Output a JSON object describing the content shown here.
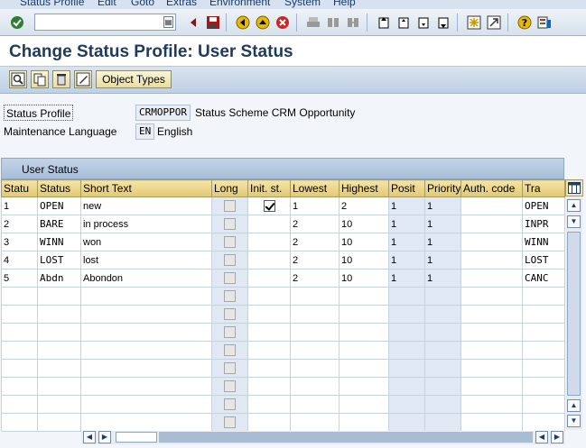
{
  "menu": [
    "Status Profile",
    "Edit",
    "Goto",
    "Extras",
    "Environment",
    "System",
    "Help"
  ],
  "title": "Change Status Profile: User Status",
  "app_toolbar": {
    "object_types_label": "Object Types"
  },
  "header": {
    "status_profile_label": "Status Profile",
    "status_profile_value": "CRMOPPOR",
    "status_profile_desc": "Status Scheme CRM Opportunity",
    "maint_lang_label": "Maintenance Language",
    "maint_lang_value": "EN",
    "maint_lang_desc": "English"
  },
  "table": {
    "title": "User Status",
    "columns": [
      "Statu",
      "Status",
      "Short Text",
      "Long",
      "Init. st.",
      "Lowest",
      "Highest",
      "Posit",
      "Priority",
      "Auth. code",
      "Tra"
    ],
    "rows": [
      {
        "num": "1",
        "status": "OPEN",
        "text": "new",
        "init": true,
        "lowest": "1",
        "highest": "2",
        "posit": "1",
        "priority": "1",
        "auth": "",
        "tra": "OPEN"
      },
      {
        "num": "2",
        "status": "BARE",
        "text": "in process",
        "init": false,
        "lowest": "2",
        "highest": "10",
        "posit": "1",
        "priority": "1",
        "auth": "",
        "tra": "INPR"
      },
      {
        "num": "3",
        "status": "WINN",
        "text": "won",
        "init": false,
        "lowest": "2",
        "highest": "10",
        "posit": "1",
        "priority": "1",
        "auth": "",
        "tra": "WINN"
      },
      {
        "num": "4",
        "status": "LOST",
        "text": "lost",
        "init": false,
        "lowest": "2",
        "highest": "10",
        "posit": "1",
        "priority": "1",
        "auth": "",
        "tra": "LOST"
      },
      {
        "num": "5",
        "status": "Abdn",
        "text": "Abondon",
        "init": false,
        "lowest": "2",
        "highest": "10",
        "posit": "1",
        "priority": "1",
        "auth": "",
        "tra": "CANC"
      }
    ],
    "empty_rows": 8
  }
}
